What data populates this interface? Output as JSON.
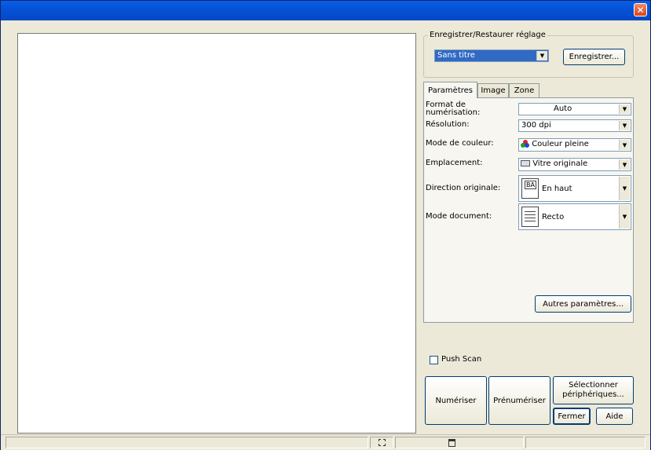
{
  "titlebar": {
    "close_glyph": "✕"
  },
  "preset_group": {
    "legend": "Enregistrer/Restaurer réglage",
    "selected": "Sans titre",
    "save_button": "Enregistrer..."
  },
  "tabs": [
    "Paramètres",
    "Image",
    "Zone"
  ],
  "settings": {
    "format_label_1": "Format de",
    "format_label_2": "numérisation:",
    "format_value": "Auto",
    "resolution_label": "Résolution:",
    "resolution_value": "300 dpi",
    "color_label": "Mode de couleur:",
    "color_value": "Couleur pleine",
    "location_label": "Emplacement:",
    "location_value": "Vitre originale",
    "direction_label": "Direction originale:",
    "direction_value": "En haut",
    "direction_icon_text": "BA",
    "doc_label": "Mode document:",
    "doc_value": "Recto",
    "more_button": "Autres paramètres..."
  },
  "push_scan": {
    "label": "Push Scan",
    "checked": false
  },
  "buttons": {
    "scan": "Numériser",
    "prescan": "Prénumériser",
    "select_1": "Sélectionner",
    "select_2": "périphériques...",
    "close": "Fermer",
    "help": "Aide"
  }
}
